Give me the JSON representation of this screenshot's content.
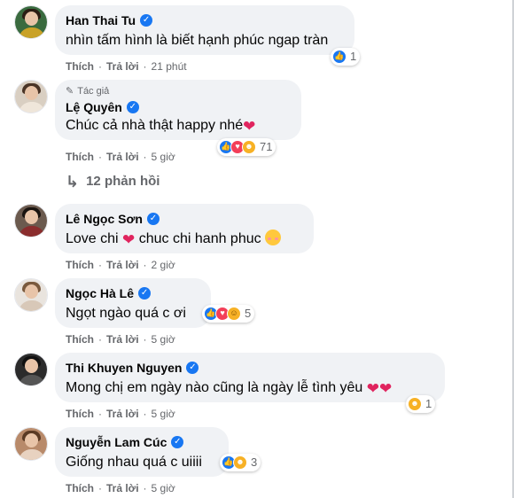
{
  "comments": [
    {
      "name": "Han Thai Tu",
      "text": "nhìn tấm hình là biết hạnh phúc ngap tràn",
      "like_label": "Thích",
      "reply_label": "Trả lời",
      "time": "21 phút",
      "reaction_count": "1",
      "reactions": [
        "like-icon"
      ],
      "avatar_colors": {
        "bg": "#3a6b3f",
        "hair": "#2b1d14",
        "body": "#c9a227"
      }
    },
    {
      "author_tag": "Tác giả",
      "name": "Lệ Quyên",
      "text": "Chúc cả nhà thật happy nhé",
      "text_emoji": "heart-sparkle-icon",
      "like_label": "Thích",
      "reply_label": "Trả lời",
      "time": "5 giờ",
      "reaction_count": "71",
      "reactions": [
        "like-icon",
        "love-icon",
        "care-icon"
      ],
      "avatar_colors": {
        "bg": "#d9cfc2",
        "hair": "#4a3426",
        "body": "#efe6da"
      }
    },
    {
      "name": "Lê Ngọc Sơn",
      "text_before": "Love chi",
      "text_after": "chuc chi hanh phuc",
      "like_label": "Thích",
      "reply_label": "Trả lời",
      "time": "2 giờ",
      "avatar_colors": {
        "bg": "#6b5a4e",
        "hair": "#1a1410",
        "body": "#8a2d2d"
      }
    },
    {
      "name": "Ngọc Hà Lê",
      "text": "Ngọt ngào quá c ơi",
      "like_label": "Thích",
      "reply_label": "Trả lời",
      "time": "5 giờ",
      "reaction_count": "5",
      "reactions": [
        "like-icon",
        "love-icon",
        "haha-icon"
      ],
      "avatar_colors": {
        "bg": "#e9e4de",
        "hair": "#7a5a3e",
        "body": "#d8c8b8"
      }
    },
    {
      "name": "Thi Khuyen Nguyen",
      "text": "Mong chị em ngày nào cũng là ngày lễ tình yêu",
      "like_label": "Thích",
      "reply_label": "Trả lời",
      "time": "5 giờ",
      "reaction_count": "1",
      "reactions": [
        "care-icon"
      ],
      "avatar_colors": {
        "bg": "#2b2b2b",
        "hair": "#111111",
        "body": "#555555"
      }
    },
    {
      "name": "Nguyễn Lam Cúc",
      "text": "Giống nhau quá c uiiii",
      "like_label": "Thích",
      "reply_label": "Trả lời",
      "time": "5 giờ",
      "reaction_count": "3",
      "reactions": [
        "like-icon",
        "care-icon"
      ],
      "avatar_colors": {
        "bg": "#b88a6a",
        "hair": "#5a3a24",
        "body": "#e8d2c0"
      }
    }
  ],
  "replies_link": "12 phản hồi",
  "colors": {
    "accent": "#1877f2",
    "bubble": "#f0f2f5",
    "meta": "#65676b"
  }
}
